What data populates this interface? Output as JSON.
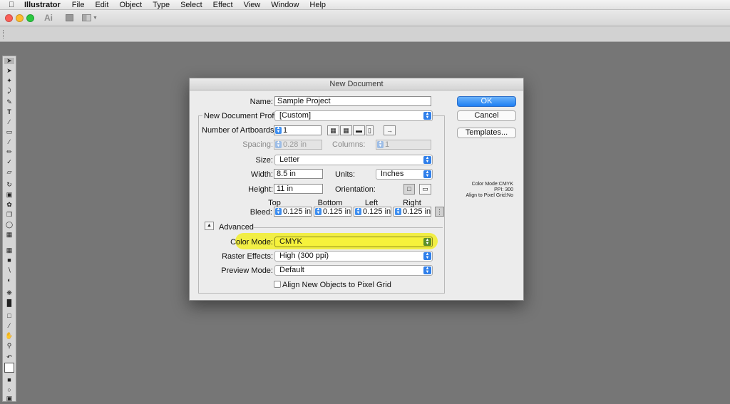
{
  "menubar": {
    "items": [
      "Illustrator",
      "File",
      "Edit",
      "Object",
      "Type",
      "Select",
      "Effect",
      "View",
      "Window",
      "Help"
    ]
  },
  "appbar": {
    "logo": "Ai"
  },
  "dialog": {
    "title": "New Document",
    "name_label": "Name:",
    "name_value": "Sample Project",
    "profile_label": "New Document Profile:",
    "profile_value": "[Custom]",
    "artboards_label": "Number of Artboards:",
    "artboards_value": "1",
    "spacing_label": "Spacing:",
    "spacing_value": "0.28 in",
    "columns_label": "Columns:",
    "columns_value": "1",
    "size_label": "Size:",
    "size_value": "Letter",
    "width_label": "Width:",
    "width_value": "8.5 in",
    "units_label": "Units:",
    "units_value": "Inches",
    "height_label": "Height:",
    "height_value": "11 in",
    "orientation_label": "Orientation:",
    "bleed_label": "Bleed:",
    "bleed_top_label": "Top",
    "bleed_bottom_label": "Bottom",
    "bleed_left_label": "Left",
    "bleed_right_label": "Right",
    "bleed_top": "0.125 in",
    "bleed_bottom": "0.125 in",
    "bleed_left": "0.125 in",
    "bleed_right": "0.125 in",
    "advanced_label": "Advanced",
    "color_mode_label": "Color Mode:",
    "color_mode_value": "CMYK",
    "raster_label": "Raster Effects:",
    "raster_value": "High (300 ppi)",
    "preview_label": "Preview Mode:",
    "preview_value": "Default",
    "align_label": "Align New Objects to Pixel Grid",
    "ok_label": "OK",
    "cancel_label": "Cancel",
    "templates_label": "Templates...",
    "summary_color": "Color Mode:CMYK",
    "summary_ppi": "PPI: 300",
    "summary_align": "Align to Pixel Grid:No"
  },
  "colors": {
    "accent": "#2f7fea",
    "highlight": "#f1ee3c",
    "canvas": "#767676"
  }
}
